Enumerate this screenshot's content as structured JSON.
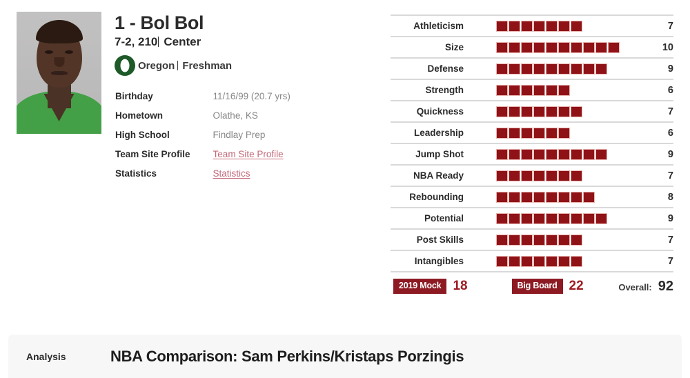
{
  "player": {
    "name": "1 - Bol Bol",
    "height_weight": "7-2, 210",
    "position": "Center",
    "school": "Oregon",
    "class": "Freshman",
    "photo_alt": "player-headshot",
    "logo_letter": "O",
    "logo_color": "#1d5a28"
  },
  "meta": {
    "rows": [
      {
        "key": "Birthday",
        "value": "11/16/99 (20.7 yrs)",
        "link": false
      },
      {
        "key": "Hometown",
        "value": "Olathe, KS",
        "link": false
      },
      {
        "key": "High School",
        "value": "Findlay Prep",
        "link": false
      },
      {
        "key": "Team Site Profile",
        "value": "Team Site Profile",
        "link": true
      },
      {
        "key": "Statistics",
        "value": "Statistics",
        "link": true
      }
    ]
  },
  "ratings": {
    "max": 10,
    "rows": [
      {
        "label": "Athleticism",
        "value": 7
      },
      {
        "label": "Size",
        "value": 10
      },
      {
        "label": "Defense",
        "value": 9
      },
      {
        "label": "Strength",
        "value": 6
      },
      {
        "label": "Quickness",
        "value": 7
      },
      {
        "label": "Leadership",
        "value": 6
      },
      {
        "label": "Jump Shot",
        "value": 9
      },
      {
        "label": "NBA Ready",
        "value": 7
      },
      {
        "label": "Rebounding",
        "value": 8
      },
      {
        "label": "Potential",
        "value": 9
      },
      {
        "label": "Post Skills",
        "value": 7
      },
      {
        "label": "Intangibles",
        "value": 7
      }
    ],
    "footer": {
      "mock_label": "2019 Mock",
      "mock_value": "18",
      "big_board_label": "Big Board",
      "big_board_value": "22",
      "overall_label": "Overall:",
      "overall_value": "92"
    }
  },
  "analysis": {
    "label": "Analysis",
    "text": "NBA Comparison: Sam Perkins/Kristaps Porzingis"
  },
  "colors": {
    "pip_fill": "#8f1216",
    "pip_border": "#e7b4b0",
    "badge_bg": "#8d1a23",
    "badge_num": "#9e1b22",
    "link": "#c2687a",
    "rule": "#d9d9d9",
    "panel_bg": "#f7f7f7"
  }
}
